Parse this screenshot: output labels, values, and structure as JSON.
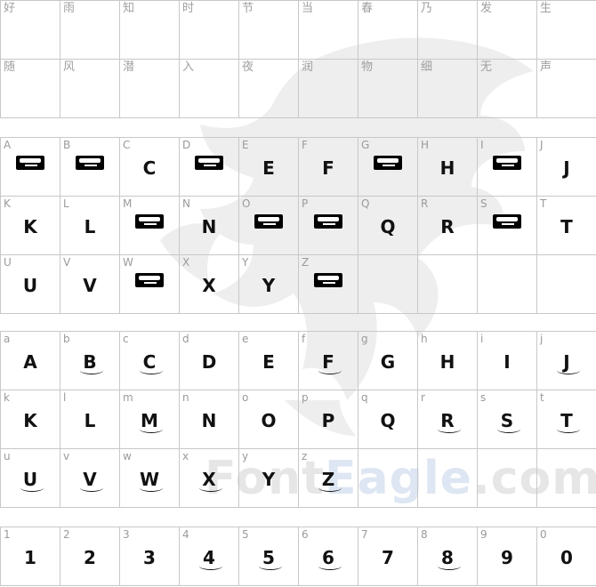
{
  "watermark": {
    "text_gray": "Font",
    "text_blue": "Eagle",
    "text_end": ".com"
  },
  "cjk_row1": [
    "好",
    "雨",
    "知",
    "时",
    "节",
    "当",
    "春",
    "乃",
    "发",
    "生"
  ],
  "cjk_row2": [
    "随",
    "风",
    "潜",
    "入",
    "夜",
    "润",
    "物",
    "细",
    "无",
    "声"
  ],
  "upper": [
    {
      "label": "A",
      "glyph": "",
      "logo": true
    },
    {
      "label": "B",
      "glyph": "",
      "logo": true
    },
    {
      "label": "C",
      "glyph": "C",
      "logo": false
    },
    {
      "label": "D",
      "glyph": "",
      "logo": true
    },
    {
      "label": "E",
      "glyph": "E",
      "logo": false
    },
    {
      "label": "F",
      "glyph": "F",
      "logo": false
    },
    {
      "label": "G",
      "glyph": "",
      "logo": true
    },
    {
      "label": "H",
      "glyph": "H",
      "logo": false
    },
    {
      "label": "I",
      "glyph": "",
      "logo": true
    },
    {
      "label": "J",
      "glyph": "J",
      "logo": false
    },
    {
      "label": "K",
      "glyph": "K",
      "logo": false
    },
    {
      "label": "L",
      "glyph": "L",
      "logo": false
    },
    {
      "label": "M",
      "glyph": "",
      "logo": true
    },
    {
      "label": "N",
      "glyph": "N",
      "logo": false
    },
    {
      "label": "O",
      "glyph": "",
      "logo": true
    },
    {
      "label": "P",
      "glyph": "",
      "logo": true
    },
    {
      "label": "Q",
      "glyph": "Q",
      "logo": false
    },
    {
      "label": "R",
      "glyph": "R",
      "logo": false
    },
    {
      "label": "S",
      "glyph": "",
      "logo": true
    },
    {
      "label": "T",
      "glyph": "T",
      "logo": false
    },
    {
      "label": "U",
      "glyph": "U",
      "logo": false
    },
    {
      "label": "V",
      "glyph": "V",
      "logo": false
    },
    {
      "label": "W",
      "glyph": "",
      "logo": true
    },
    {
      "label": "X",
      "glyph": "X",
      "logo": false
    },
    {
      "label": "Y",
      "glyph": "Y",
      "logo": false
    },
    {
      "label": "Z",
      "glyph": "",
      "logo": true
    },
    {
      "label": "",
      "glyph": "",
      "logo": false
    },
    {
      "label": "",
      "glyph": "",
      "logo": false
    },
    {
      "label": "",
      "glyph": "",
      "logo": false
    },
    {
      "label": "",
      "glyph": "",
      "logo": false
    }
  ],
  "lower": [
    {
      "label": "a",
      "glyph": "A"
    },
    {
      "label": "b",
      "glyph": "B"
    },
    {
      "label": "c",
      "glyph": "C"
    },
    {
      "label": "d",
      "glyph": "D"
    },
    {
      "label": "e",
      "glyph": "E"
    },
    {
      "label": "f",
      "glyph": "F"
    },
    {
      "label": "g",
      "glyph": "G"
    },
    {
      "label": "h",
      "glyph": "H"
    },
    {
      "label": "i",
      "glyph": "I"
    },
    {
      "label": "j",
      "glyph": "J"
    },
    {
      "label": "k",
      "glyph": "K"
    },
    {
      "label": "l",
      "glyph": "L"
    },
    {
      "label": "m",
      "glyph": "M"
    },
    {
      "label": "n",
      "glyph": "N"
    },
    {
      "label": "o",
      "glyph": "O"
    },
    {
      "label": "p",
      "glyph": "P"
    },
    {
      "label": "q",
      "glyph": "Q"
    },
    {
      "label": "r",
      "glyph": "R"
    },
    {
      "label": "s",
      "glyph": "S"
    },
    {
      "label": "t",
      "glyph": "T"
    },
    {
      "label": "u",
      "glyph": "U"
    },
    {
      "label": "v",
      "glyph": "V"
    },
    {
      "label": "w",
      "glyph": "W"
    },
    {
      "label": "x",
      "glyph": "X"
    },
    {
      "label": "y",
      "glyph": "Y"
    },
    {
      "label": "z",
      "glyph": "Z"
    },
    {
      "label": "",
      "glyph": ""
    },
    {
      "label": "",
      "glyph": ""
    },
    {
      "label": "",
      "glyph": ""
    },
    {
      "label": "",
      "glyph": ""
    }
  ],
  "digits": [
    {
      "label": "1",
      "glyph": "1"
    },
    {
      "label": "2",
      "glyph": "2"
    },
    {
      "label": "3",
      "glyph": "3"
    },
    {
      "label": "4",
      "glyph": "4"
    },
    {
      "label": "5",
      "glyph": "5"
    },
    {
      "label": "6",
      "glyph": "6"
    },
    {
      "label": "7",
      "glyph": "7"
    },
    {
      "label": "8",
      "glyph": "8"
    },
    {
      "label": "9",
      "glyph": "9"
    },
    {
      "label": "0",
      "glyph": "0"
    }
  ]
}
